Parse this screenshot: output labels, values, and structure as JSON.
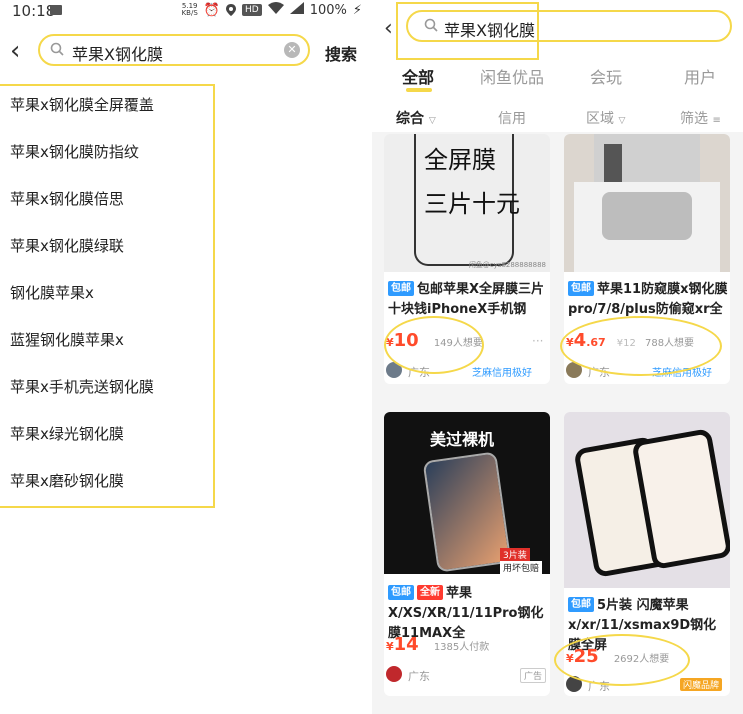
{
  "left": {
    "status": {
      "time": "10:18",
      "speed_value": "5.19",
      "speed_unit": "KB/S",
      "hd": "HD",
      "battery": "100%"
    },
    "search": {
      "query": "苹果X钢化膜",
      "button": "搜索"
    },
    "suggestions": [
      "苹果x钢化膜全屏覆盖",
      "苹果x钢化膜防指纹",
      "苹果x钢化膜倍思",
      "苹果x钢化膜绿联",
      "钢化膜苹果x",
      "蓝猩钢化膜苹果x",
      "苹果x手机壳送钢化膜",
      "苹果x绿光钢化膜",
      "苹果x磨砂钢化膜"
    ]
  },
  "right": {
    "search": {
      "query": "苹果X钢化膜"
    },
    "tabs": [
      "全部",
      "闲鱼优品",
      "会玩",
      "用户"
    ],
    "filters": [
      "综合",
      "信用",
      "区域",
      "筛选"
    ],
    "cards": [
      {
        "img_text": "全屏膜\n三片十元",
        "watermark": "闲鱼@cys8288888888",
        "tags": [
          "包邮"
        ],
        "title": "包邮苹果X全屏膜三片十块钱iPhoneX手机钢",
        "price": "10",
        "price_dec": "",
        "orig": "",
        "want": "149人想要",
        "loc": "广东",
        "credit": "芝麻信用极好",
        "ad": "",
        "more": "···"
      },
      {
        "img_text": "",
        "watermark": "",
        "tags": [
          "包邮"
        ],
        "title": "苹果11防窥膜x钢化膜pro/7/8/plus防偷窥xr全",
        "price": "4",
        "price_dec": ".67",
        "orig": "¥12",
        "want": "788人想要",
        "loc": "广东",
        "credit": "芝麻信用极好",
        "ad": "",
        "more": ""
      },
      {
        "img_text": "美过裸机",
        "watermark": "",
        "badge1": "3片装",
        "badge2": "用坏包赔",
        "tags": [
          "包邮",
          "全新"
        ],
        "title": "苹果X/XS/XR/11/11Pro钢化膜11MAX全",
        "price": "14",
        "price_dec": "",
        "orig": "",
        "want": "1385人付款",
        "loc": "广东",
        "credit": "",
        "ad": "广告",
        "more": ""
      },
      {
        "img_text": "",
        "watermark": "",
        "tags": [
          "包邮"
        ],
        "title": "5片装 闪魔苹果x/xr/11/xsmax9D钢化膜全屏",
        "price": "25",
        "price_dec": "",
        "orig": "",
        "want": "2692人想要",
        "loc": "广东",
        "credit": "",
        "ad": "",
        "brand": "闪魔品牌",
        "more": ""
      }
    ]
  },
  "colors": {
    "accent": "#f5d84a",
    "price": "#ff4b2b",
    "tag_blue": "#2f9bff",
    "tag_red": "#ff3b30"
  }
}
